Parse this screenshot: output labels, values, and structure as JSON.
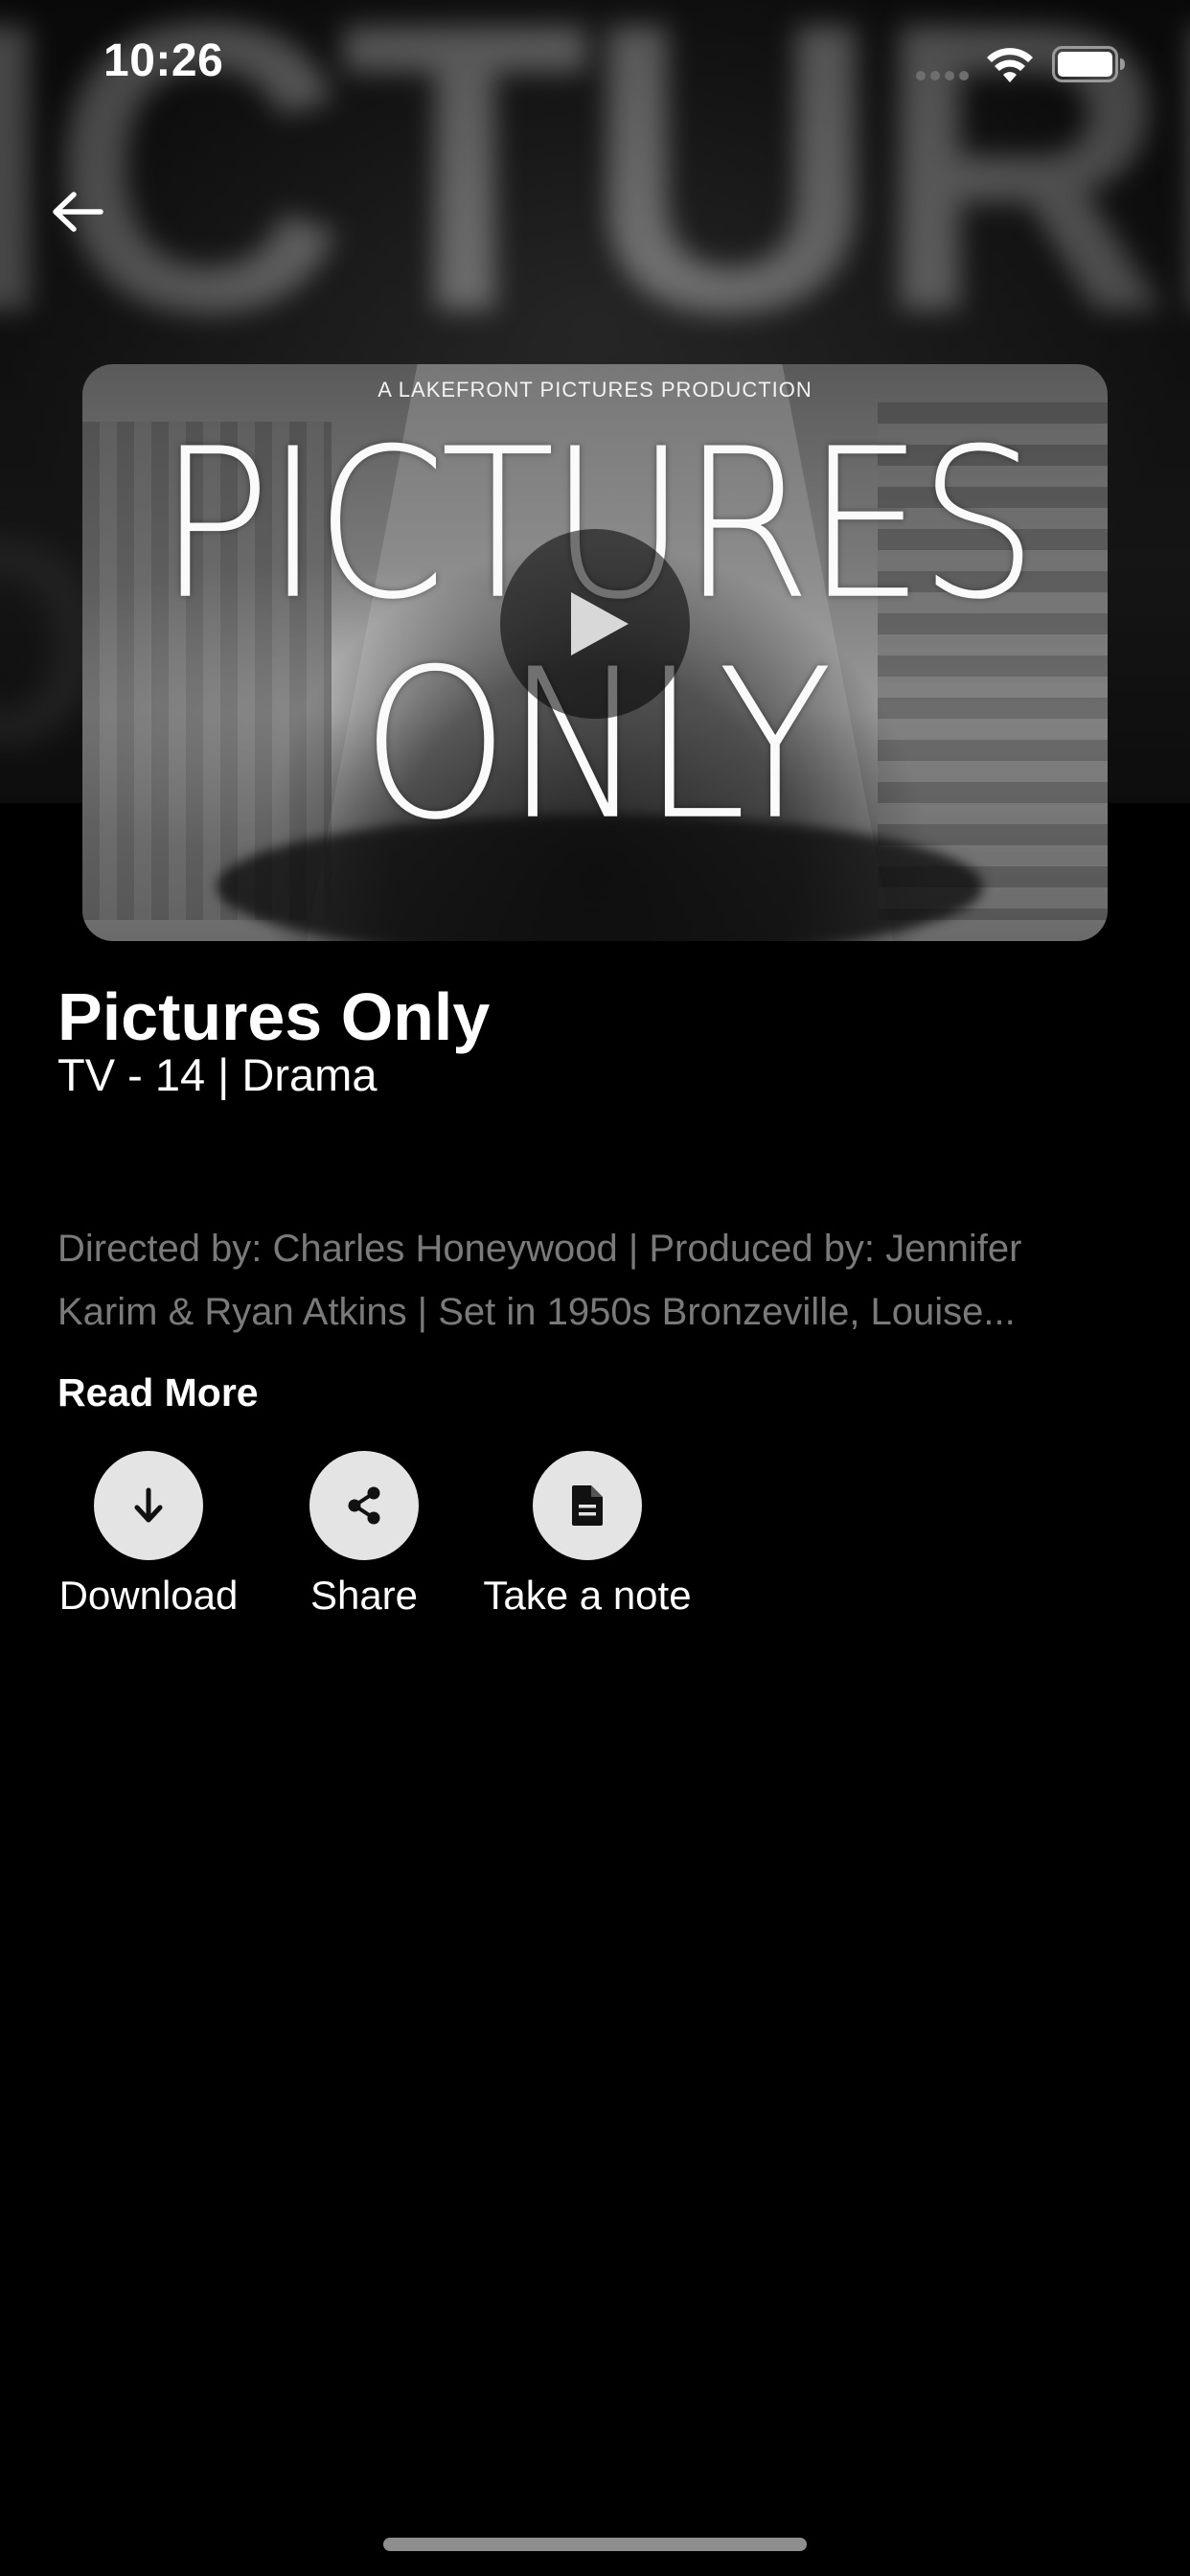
{
  "status_bar": {
    "time": "10:26"
  },
  "navigation": {
    "back_icon": "arrow-left-icon"
  },
  "poster": {
    "credit_line": "A LAKEFRONT PICTURES PRODUCTION",
    "title_line_1": "PICTURES",
    "title_line_2": "ONLY",
    "play_icon": "play-icon"
  },
  "show": {
    "title": "Pictures Only",
    "meta": "TV - 14 | Drama",
    "description_line_1": "Directed by: Charles Honeywood | Produced by: Jennifer",
    "description_line_2": "Karim & Ryan Atkins |  Set in 1950s Bronzeville, Louise...",
    "read_more": "Read More"
  },
  "actions": {
    "download": {
      "label": "Download",
      "icon": "arrow-down-icon"
    },
    "share": {
      "label": "Share",
      "icon": "share-icon"
    },
    "note": {
      "label": "Take a note",
      "icon": "document-icon"
    }
  },
  "colors": {
    "background": "#000000",
    "text_primary": "#ffffff",
    "text_secondary": "#7a7a7a",
    "action_circle": "#e4e4e4"
  }
}
